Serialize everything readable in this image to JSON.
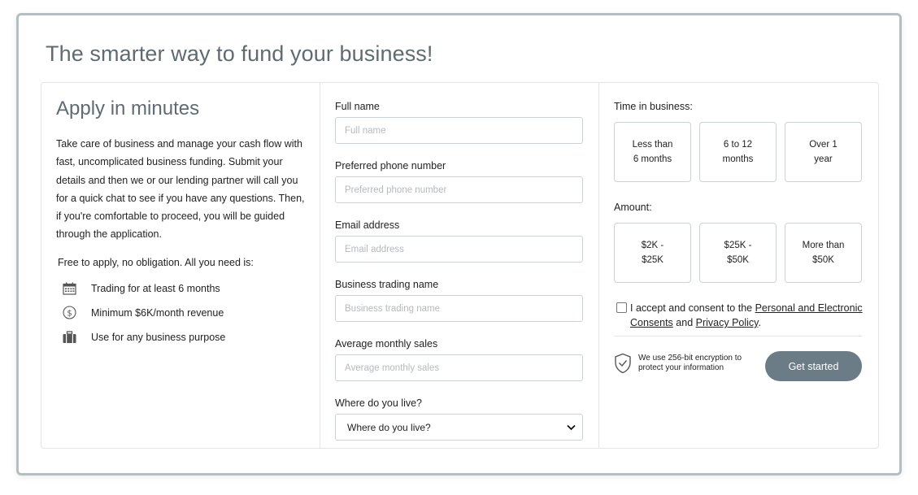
{
  "headline": "The smarter way to fund your business!",
  "left": {
    "title": "Apply in minutes",
    "description": "Take care of business and manage your cash flow with fast, uncomplicated business funding. Submit your details and then we or our lending partner will call you for a quick chat to see if you have any questions. Then, if you're comfortable to proceed, you will be guided through the application.",
    "free_text": "Free to apply, no obligation. All you need is:",
    "requirements": [
      {
        "icon": "calendar-icon",
        "label": "Trading for at least 6 months"
      },
      {
        "icon": "dollar-coin-icon",
        "label": "Minimum $6K/month revenue"
      },
      {
        "icon": "briefcase-icon",
        "label": "Use for any business purpose"
      }
    ]
  },
  "form": {
    "full_name": {
      "label": "Full name",
      "placeholder": "Full name"
    },
    "phone": {
      "label": "Preferred phone number",
      "placeholder": "Preferred phone number"
    },
    "email": {
      "label": "Email address",
      "placeholder": "Email address"
    },
    "trading_name": {
      "label": "Business trading name",
      "placeholder": "Business trading name"
    },
    "monthly_sales": {
      "label": "Average monthly sales",
      "placeholder": "Average monthly sales"
    },
    "residence": {
      "label": "Where do you live?",
      "selected": "Where do you live?"
    }
  },
  "time_in_business": {
    "label": "Time in business:",
    "options": [
      {
        "line1": "Less than",
        "line2": "6 months"
      },
      {
        "line1": "6 to 12",
        "line2": "months"
      },
      {
        "line1": "Over 1",
        "line2": "year"
      }
    ]
  },
  "amount": {
    "label": "Amount:",
    "options": [
      {
        "line1": "$2K -",
        "line2": "$25K"
      },
      {
        "line1": "$25K -",
        "line2": "$50K"
      },
      {
        "line1": "More than",
        "line2": "$50K"
      }
    ]
  },
  "consent": {
    "prefix": "I accept and consent to the ",
    "link1": "Personal and Electronic Consents",
    "middle": " and ",
    "link2": "Privacy Policy",
    "suffix": "."
  },
  "security": {
    "text": "We use 256-bit encryption to protect your information",
    "icon": "shield-check-icon"
  },
  "cta": {
    "label": "Get started"
  },
  "colors": {
    "heading": "#5f6b73",
    "cta_bg": "#6b7c87",
    "border": "#cdd2d5"
  }
}
